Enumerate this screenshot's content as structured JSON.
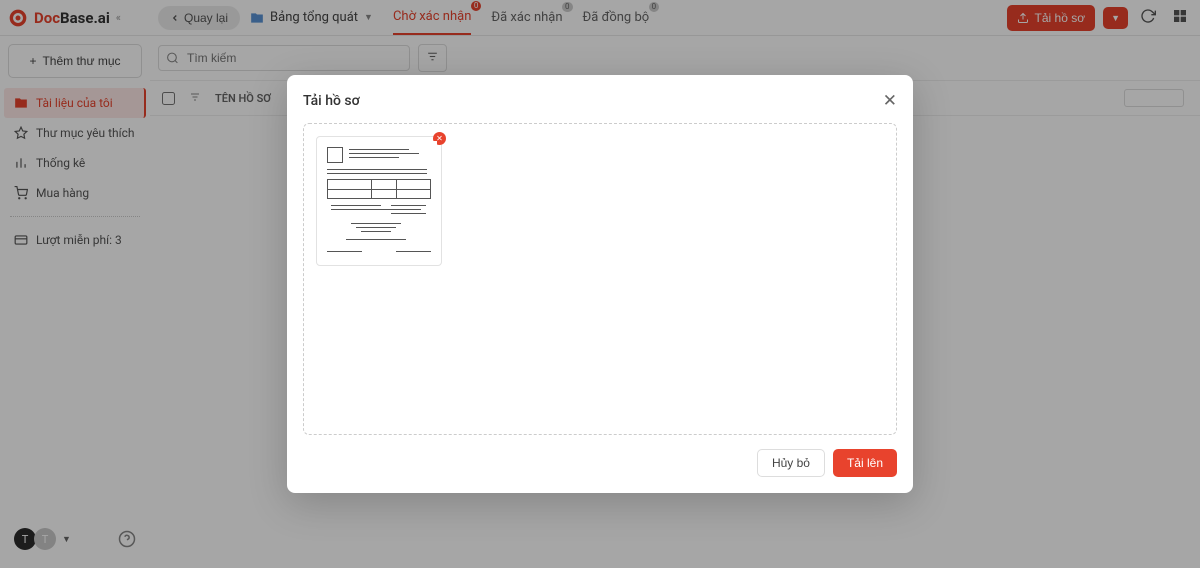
{
  "brand": {
    "name_prefix": "Doc",
    "name_mid": "Base",
    "name_suffix": ".ai"
  },
  "header": {
    "back": "Quay lại",
    "folder_title": "Bảng tổng quát",
    "upload_label": "Tải hồ sơ"
  },
  "tabs": [
    {
      "label": "Chờ xác nhận",
      "badge": "0",
      "active": true
    },
    {
      "label": "Đã xác nhận",
      "badge": "0",
      "active": false
    },
    {
      "label": "Đã đồng bộ",
      "badge": "0",
      "active": false
    }
  ],
  "sidebar": {
    "add_folder": "Thêm thư mục",
    "items": [
      {
        "label": "Tài liệu của tôi",
        "active": true,
        "icon": "folder"
      },
      {
        "label": "Thư mục yêu thích",
        "active": false,
        "icon": "star"
      },
      {
        "label": "Thống kê",
        "active": false,
        "icon": "chart"
      },
      {
        "label": "Mua hàng",
        "active": false,
        "icon": "cart"
      }
    ],
    "quota": "Lượt miễn phí: 3",
    "avatar1": "T",
    "avatar2": "T"
  },
  "search": {
    "placeholder": "Tìm kiếm"
  },
  "table": {
    "col_name": "TÊN HỒ SƠ"
  },
  "modal": {
    "title": "Tải hồ sơ",
    "cancel": "Hủy bỏ",
    "submit": "Tải lên"
  }
}
